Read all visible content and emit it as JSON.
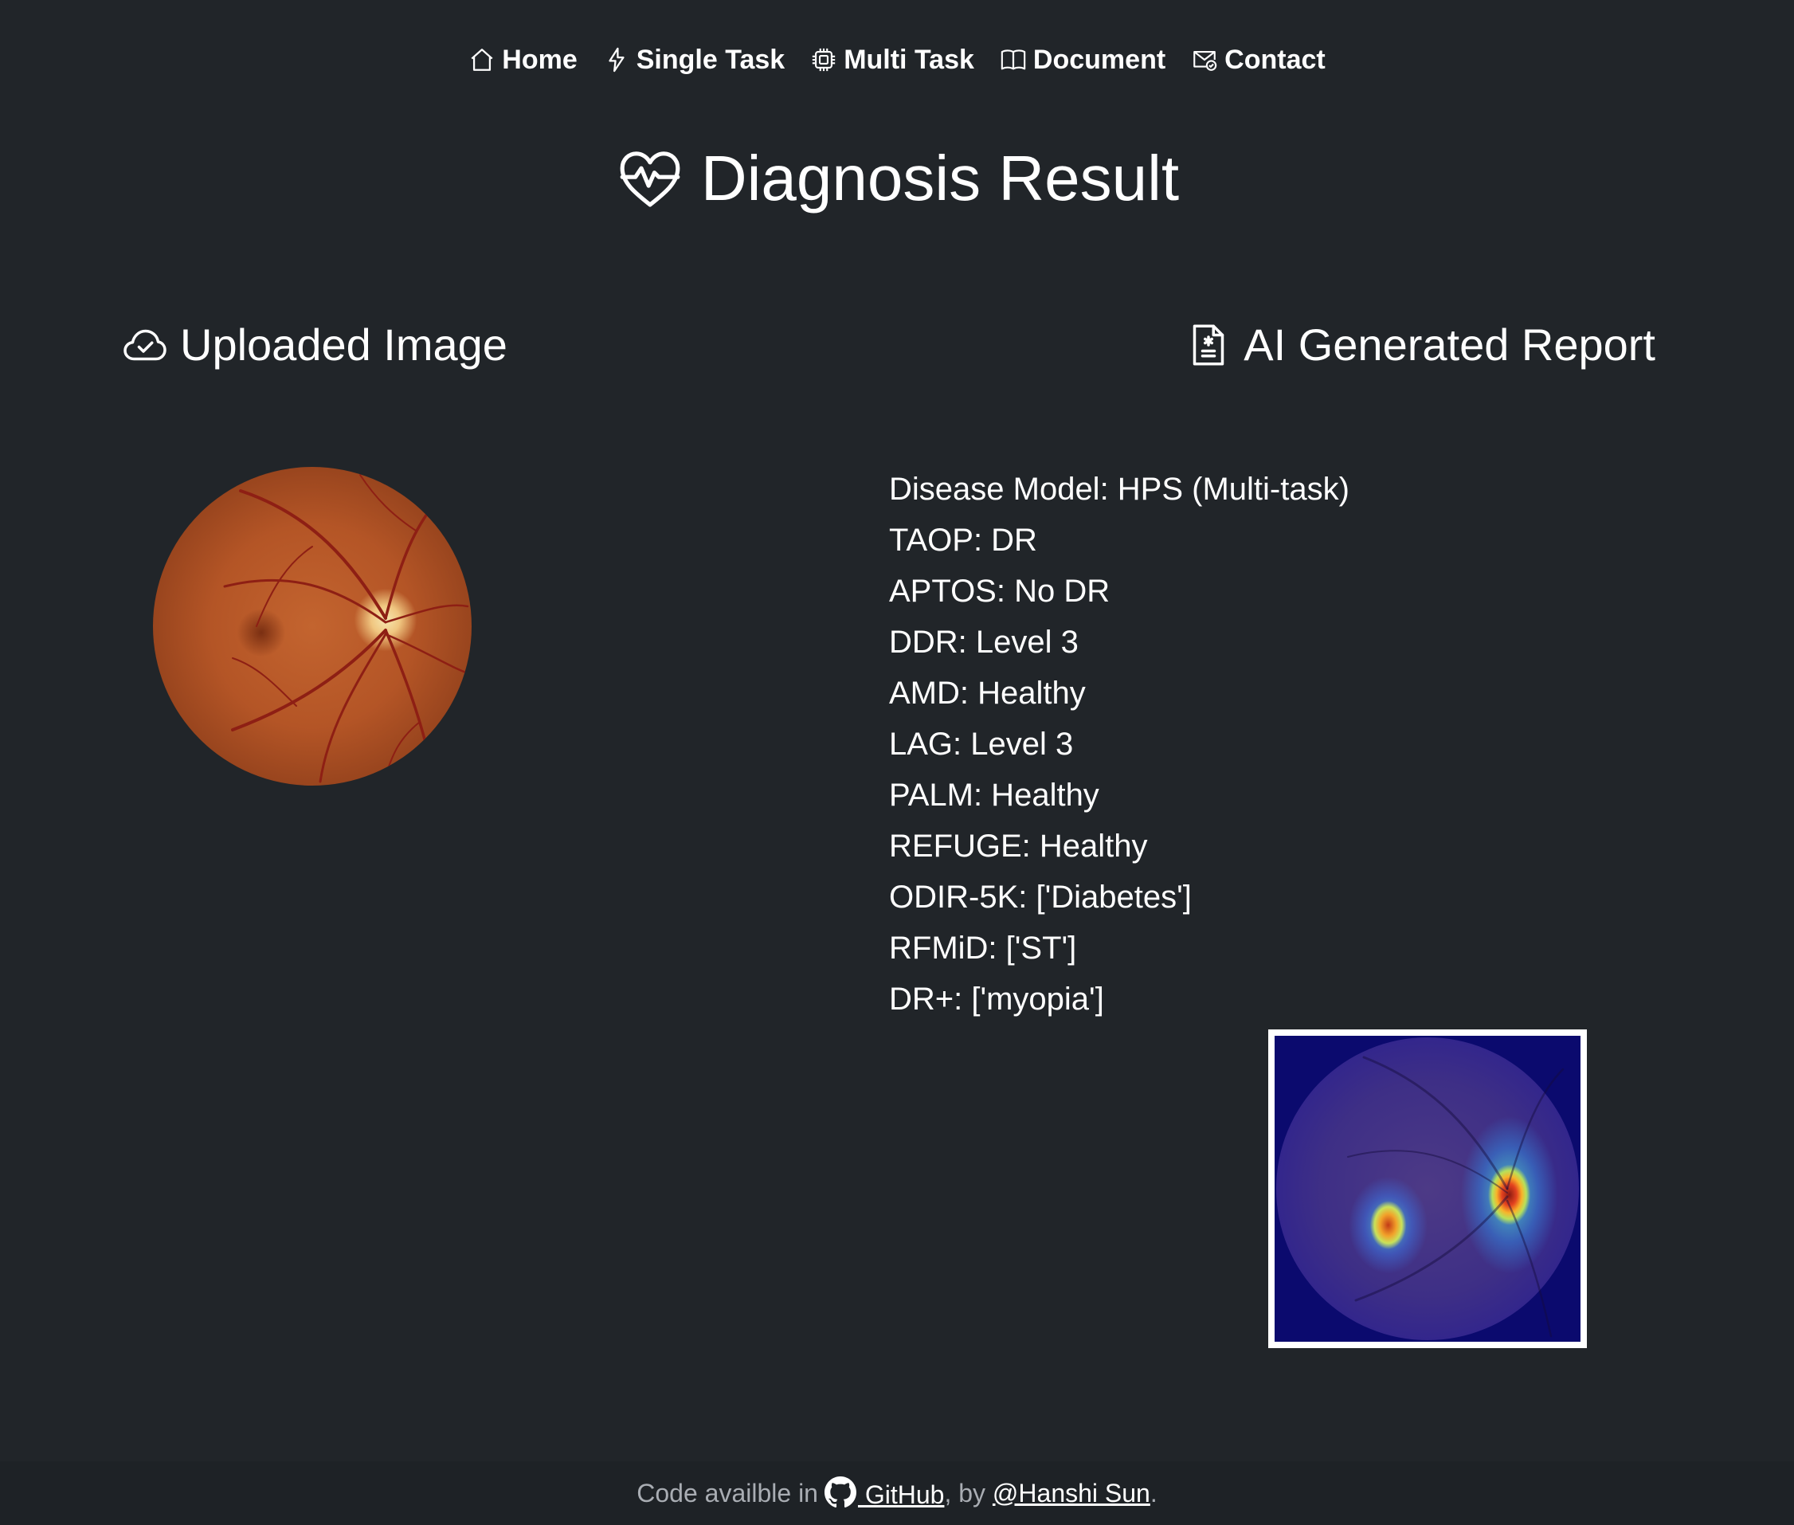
{
  "nav": {
    "items": [
      {
        "label": "Home",
        "icon": "house-icon"
      },
      {
        "label": "Single Task",
        "icon": "lightning-icon"
      },
      {
        "label": "Multi Task",
        "icon": "cpu-icon"
      },
      {
        "label": "Document",
        "icon": "book-icon"
      },
      {
        "label": "Contact",
        "icon": "envelope-check-icon"
      }
    ]
  },
  "title": {
    "text": "Diagnosis Result",
    "icon": "heart-pulse-icon"
  },
  "uploaded": {
    "heading": "Uploaded Image",
    "icon": "cloud-check-icon"
  },
  "report": {
    "heading": "AI Generated Report",
    "icon": "file-medical-icon",
    "lines": [
      "Disease Model: HPS (Multi-task)",
      "TAOP: DR",
      "APTOS: No DR",
      "DDR: Level 3",
      "AMD: Healthy",
      "LAG: Level 3",
      "PALM: Healthy",
      "REFUGE: Healthy",
      "ODIR-5K: ['Diabetes']",
      "RFMiD: ['ST']",
      "DR+: ['myopia']"
    ]
  },
  "footer": {
    "prefix": "Code availble in",
    "github_label": " GitHub",
    "sep": ", by ",
    "author_label": "@Hanshi Sun",
    "suffix": "."
  },
  "colors": {
    "background": "#212529",
    "footer_background": "#1e2226",
    "text": "#ffffff",
    "muted_text": "#a9adb3"
  }
}
